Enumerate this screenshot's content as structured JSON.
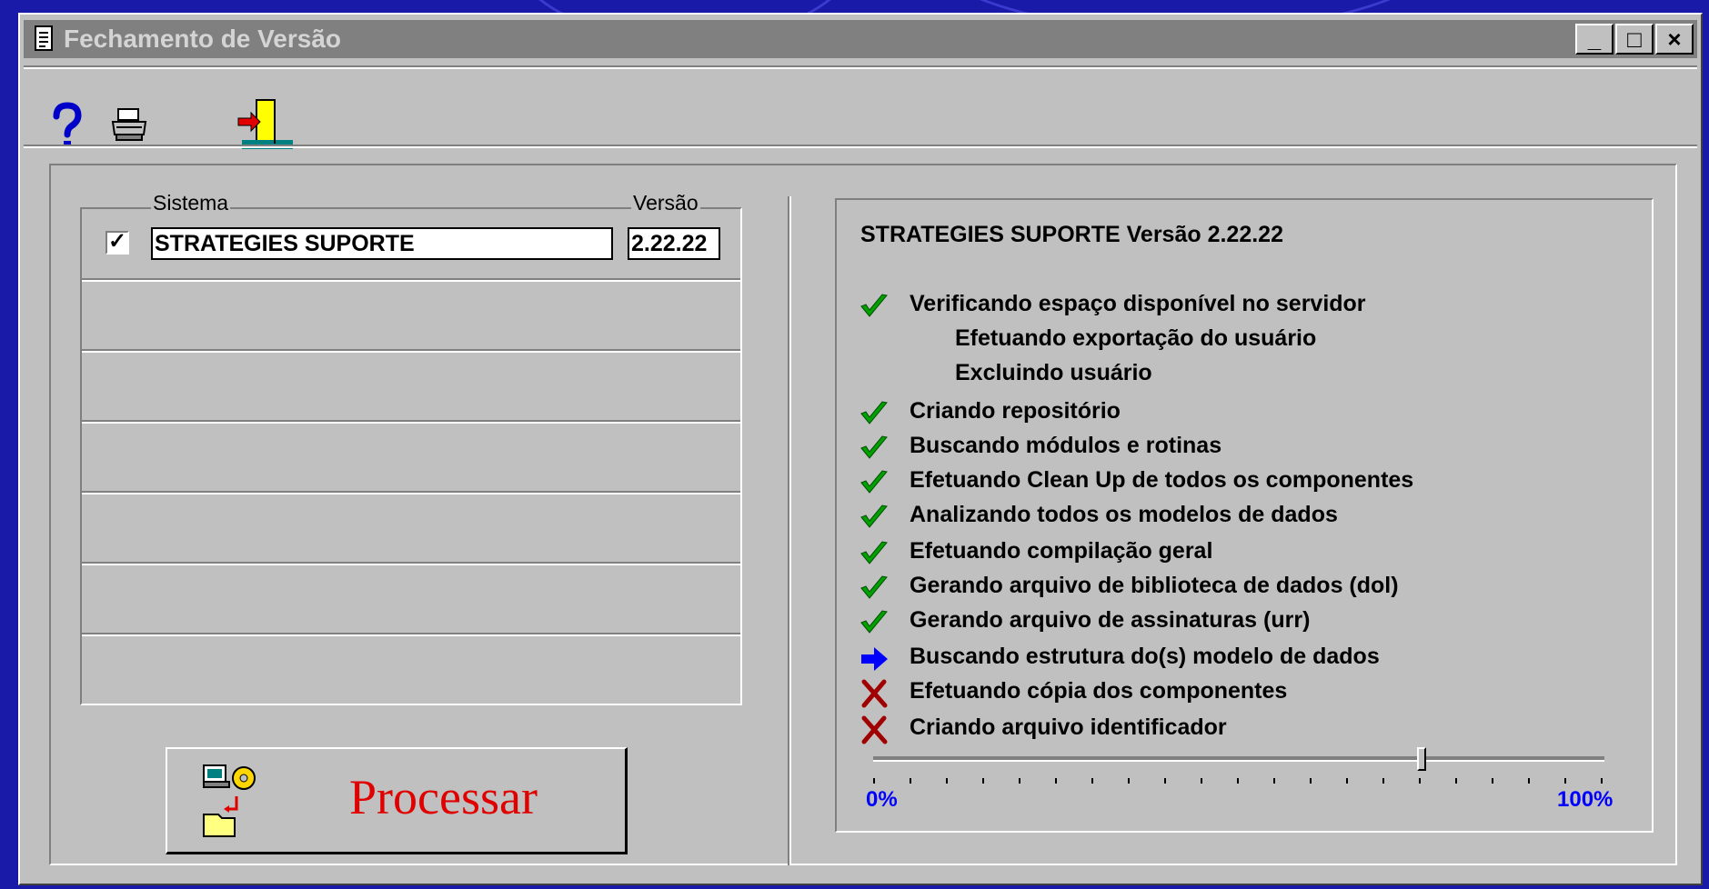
{
  "window": {
    "title": "Fechamento de Versão",
    "controls": {
      "minimize": "_",
      "maximize": "□",
      "close": "×"
    }
  },
  "toolbar": {
    "help_icon": "question-mark-icon",
    "print_icon": "printer-icon",
    "exit_icon": "exit-door-icon"
  },
  "systems": {
    "col_sistema": "Sistema",
    "col_versao": "Versão",
    "rows": [
      {
        "checked": true,
        "name": "STRATEGIES SUPORTE",
        "version": "2.22.22"
      }
    ]
  },
  "process_button": {
    "label": "Processar"
  },
  "log": {
    "title": "STRATEGIES SUPORTE Versão 2.22.22",
    "steps": [
      {
        "status": "done",
        "label": "Verificando espaço disponível no servidor"
      },
      {
        "status": "none",
        "label": "Efetuando exportação do usuário"
      },
      {
        "status": "none",
        "label": "Excluindo usuário"
      },
      {
        "status": "done",
        "label": "Criando repositório"
      },
      {
        "status": "done",
        "label": "Buscando módulos e rotinas"
      },
      {
        "status": "done",
        "label": "Efetuando Clean Up de todos os componentes"
      },
      {
        "status": "done",
        "label": "Analizando todos os modelos de dados"
      },
      {
        "status": "done",
        "label": "Efetuando compilação geral"
      },
      {
        "status": "done",
        "label": "Gerando arquivo de biblioteca de dados (dol)"
      },
      {
        "status": "done",
        "label": "Gerando arquivo de assinaturas (urr)"
      },
      {
        "status": "current",
        "label": "Buscando estrutura do(s) modelo de dados"
      },
      {
        "status": "failed",
        "label": "Efetuando cópia dos componentes"
      },
      {
        "status": "failed",
        "label": "Criando arquivo identificador"
      }
    ],
    "progress": {
      "min_label": "0%",
      "max_label": "100%",
      "value": 0.75
    }
  },
  "colors": {
    "done": "#00a000",
    "current": "#0000ff",
    "failed": "#a00000",
    "accent_text": "#e00000"
  }
}
